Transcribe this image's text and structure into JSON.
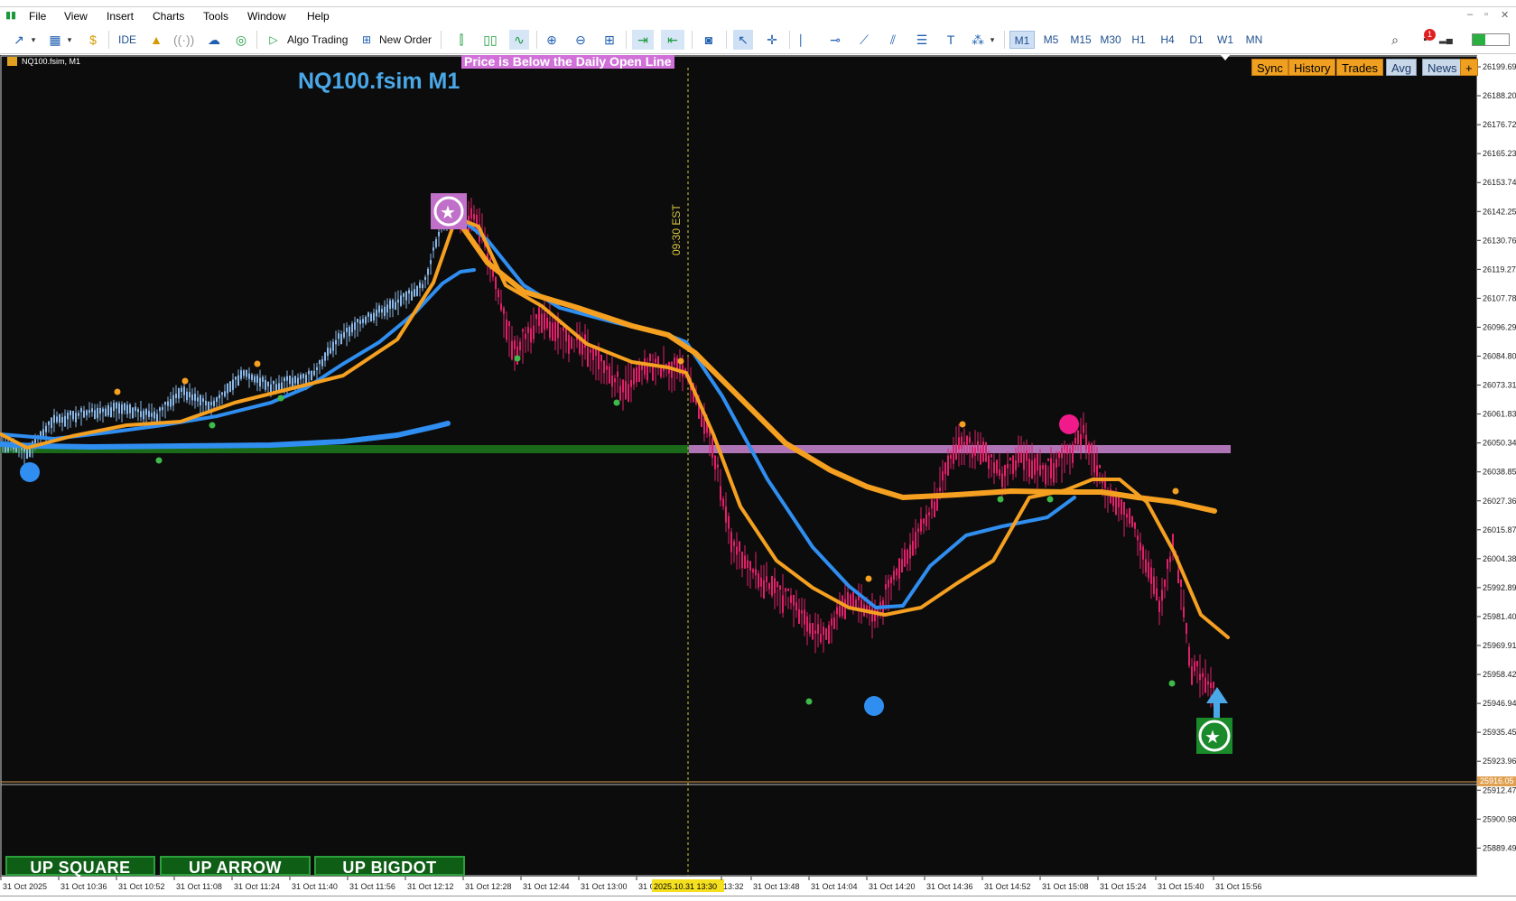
{
  "menu": {
    "items": [
      "File",
      "View",
      "Insert",
      "Charts",
      "Tools",
      "Window",
      "Help"
    ]
  },
  "toolbar": {
    "ide_label": "IDE",
    "algo_trading_label": "Algo Trading",
    "new_order_label": "New Order",
    "timeframes": [
      "M1",
      "M5",
      "M15",
      "M30",
      "H1",
      "H4",
      "D1",
      "W1",
      "MN"
    ],
    "active_timeframe": "M1",
    "notification_count": "1"
  },
  "chart": {
    "symbol_label": "NQ100.fsim, M1",
    "big_title": "NQ100.fsim M1",
    "status_banner": "Price is Below the Daily Open Line",
    "session_label": "09:30 EST",
    "buttons": [
      "Sync",
      "History",
      "Trades",
      "Avg",
      "News",
      "+"
    ],
    "bottom_buttons": [
      "UP SQUARE",
      "UP ARROW",
      "UP BIGDOT"
    ],
    "current_price": "25916.05",
    "price_axis": [
      "26199.69",
      "26188.20",
      "26176.72",
      "26165.23",
      "26153.74",
      "26142.25",
      "26130.76",
      "26119.27",
      "26107.78",
      "26096.29",
      "26084.80",
      "26073.31",
      "26061.83",
      "26050.34",
      "26038.85",
      "26027.36",
      "26015.87",
      "26004.38",
      "25992.89",
      "25981.40",
      "25969.91",
      "25958.42",
      "25946.94",
      "25935.45",
      "25923.96",
      "25912.47",
      "25900.98",
      "25889.49"
    ],
    "time_axis": [
      "31 Oct 2025",
      "31 Oct 10:36",
      "31 Oct 10:52",
      "31 Oct 11:08",
      "31 Oct 11:24",
      "31 Oct 11:40",
      "31 Oct 11:56",
      "31 Oct 12:12",
      "31 Oct 12:28",
      "31 Oct 12:44",
      "31 Oct 13:00",
      "31 O",
      "2025.10.31 13:30",
      "13:32",
      "31 Oct 13:48",
      "31 Oct 14:04",
      "31 Oct 14:20",
      "31 Oct 14:36",
      "31 Oct 14:52",
      "31 Oct 15:08",
      "31 Oct 15:24",
      "31 Oct 15:40",
      "31 Oct 15:56"
    ],
    "colors": {
      "background": "#0c0c0c",
      "bull_candle": "#8ab8e8",
      "bear_candle": "#e0206a",
      "ma_fast": "#2f8ef0",
      "ma_slow": "#f5a020",
      "daily_open_green": "#1a6a1a",
      "daily_open_pink": "#c080c8",
      "price_line": "#e0a050"
    }
  }
}
